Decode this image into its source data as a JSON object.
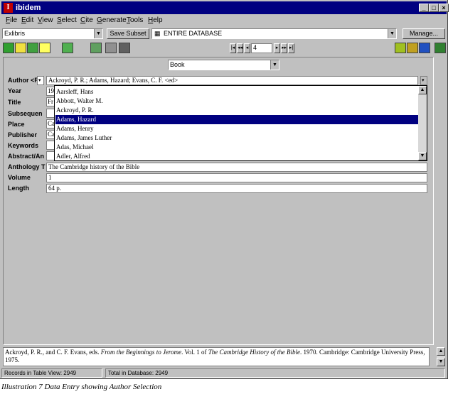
{
  "window": {
    "title": "ibidem",
    "minimize_glyph": "_",
    "maximize_glyph": "□",
    "close_glyph": "×",
    "app_icon_letter": "I"
  },
  "menu": [
    {
      "label": "File",
      "key": "F",
      "rest": "ile"
    },
    {
      "label": "Edit",
      "key": "E",
      "rest": "dit"
    },
    {
      "label": "View",
      "key": "V",
      "rest": "iew"
    },
    {
      "label": "Select",
      "key": "S",
      "rest": "elect"
    },
    {
      "label": "Cite",
      "key": "C",
      "rest": "ite"
    },
    {
      "label": "Generate",
      "key": "G",
      "rest": "enerate"
    },
    {
      "label": "Tools",
      "key": "T",
      "rest": "ools"
    },
    {
      "label": "Help",
      "key": "H",
      "rest": "elp"
    }
  ],
  "toolbar": {
    "style_value": "Exlibris",
    "save_subset_label": "Save Subset",
    "database_value": "ENTIRE DATABASE",
    "manage_label": "Manage...",
    "record_number": "4",
    "first_glyph": "|◂",
    "prev_page_glyph": "◂◂",
    "prev_glyph": "◂",
    "next_glyph": "▸",
    "next_page_glyph": "▸▸",
    "last_glyph": "▸|",
    "left_icons": [
      "view-form-icon",
      "view-card-icon",
      "view-list-icon",
      "view-blank-icon",
      "save-record-icon"
    ],
    "mid_icons": [
      "edit-record-icon",
      "search-icon",
      "find-icon"
    ],
    "right_icons": [
      "tools-icon",
      "settings-icon",
      "export-icon",
      "exit-icon"
    ]
  },
  "form": {
    "type_value": "Book",
    "fields": [
      {
        "label": "Author <F",
        "value": "Ackroyd, P. R.; Adams, Hazard; Evans, C. F. <ed>"
      },
      {
        "label": "Year",
        "value": "19"
      },
      {
        "label": "Title",
        "value": "Fr"
      },
      {
        "label": "Subsequen",
        "value": ""
      },
      {
        "label": "Place",
        "value": "Ca"
      },
      {
        "label": "Publisher",
        "value": "Ca"
      },
      {
        "label": "Keywords",
        "value": ""
      },
      {
        "label": "Abstract/An",
        "value": ""
      },
      {
        "label": "Anthology T",
        "value": "The Cambridge history of the Bible"
      },
      {
        "label": "Volume",
        "value": "1"
      },
      {
        "label": "Length",
        "value": "64 p."
      }
    ],
    "author_list": [
      {
        "name": "Aarsleff, Hans",
        "selected": false
      },
      {
        "name": "Abbott, Walter M.",
        "selected": false
      },
      {
        "name": "Ackroyd, P. R.",
        "selected": false
      },
      {
        "name": "Adams, Hazard",
        "selected": true
      },
      {
        "name": "Adams, Henry",
        "selected": false
      },
      {
        "name": "Adams, James Luther",
        "selected": false
      },
      {
        "name": "Adas, Michael",
        "selected": false
      },
      {
        "name": "Adler, Alfred",
        "selected": false
      }
    ]
  },
  "description": {
    "p1": "Ackroyd, P. R., and C. F. Evans, eds. ",
    "p2": "From the Beginnings to Jerome",
    "p3": ". Vol. 1 of ",
    "p4": "The Cambridge History of the Bible",
    "p5": ". 1970. Cambridge: Cambridge University Press, 1975."
  },
  "status": {
    "records_in_view": "Records in Table View:  2949",
    "total_in_database": "Total in Database:  2949"
  },
  "caption": "Illustration 7 Data Entry showing Author Selection",
  "colors": {
    "selection": "#000080",
    "chrome": "#c0c0c0",
    "titlebar": "#000080"
  }
}
